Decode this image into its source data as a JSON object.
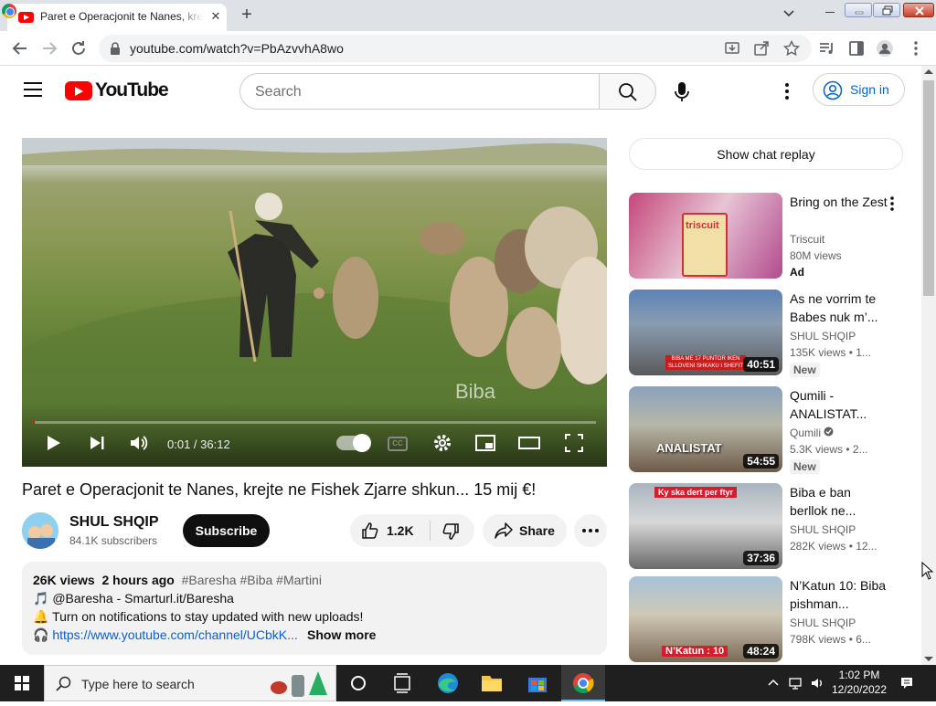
{
  "browser": {
    "tab_title": "Paret e Operacjonit te Nanes, krejte ne Fishek Zjarre shkun... 15 mij €!",
    "url": "youtube.com/watch?v=PbAzvvhA8wo"
  },
  "masthead": {
    "logo_text": "YouTube",
    "search_placeholder": "Search",
    "signin_label": "Sign in"
  },
  "player": {
    "watermark": "Biba",
    "time": "0:01 / 36:12",
    "progress_fraction": 0.0005,
    "cc_label": "CC"
  },
  "video": {
    "title": "Paret e Operacjonit te Nanes, krejte ne Fishek Zjarre shkun... 15 mij €!",
    "channel": "SHUL SHQIP",
    "subscribers": "84.1K subscribers",
    "subscribe_label": "Subscribe",
    "likes": "1.2K",
    "share_label": "Share"
  },
  "description": {
    "views": "26K views",
    "age": "2 hours ago",
    "tags": "#Baresha #Biba #Martini",
    "line1": "@Baresha - Smarturl.it/Baresha",
    "line2": "Turn on notifications to stay updated with new uploads!",
    "link": "https://www.youtube.com/channel/UCbkK...",
    "show_more": "Show more"
  },
  "sidebar": {
    "chat_replay": "Show chat replay",
    "recommendations": [
      {
        "title": "Bring on the Zest",
        "channel": "Triscuit",
        "views": "80M views",
        "badge": "Ad",
        "duration": "",
        "thumb_text": "triscuit"
      },
      {
        "title": "As ne vorrim te Babes nuk m’...",
        "channel": "SHUL SHQIP",
        "views": "135K views • 1...",
        "badge": "New",
        "duration": "40:51",
        "thumb_text": "BIBA ME 17 PUNTOR IKEN SLLOVENI SHKAKU I SHEFIT"
      },
      {
        "title": "Qumili - ANALISTAT...",
        "channel": "Qumili",
        "views": "5.3K views • 2...",
        "badge": "New",
        "duration": "54:55",
        "thumb_text": "ANALISTAT"
      },
      {
        "title": "Biba e ban berllok ne...",
        "channel": "SHUL SHQIP",
        "views": "282K views • 12...",
        "badge": "",
        "duration": "37:36",
        "thumb_text": "Ky ska dert per ftyr"
      },
      {
        "title": "N’Katun 10: Biba pishman...",
        "channel": "SHUL SHQIP",
        "views": "798K views • 6...",
        "badge": "",
        "duration": "48:24",
        "thumb_text": "N’Katun : 10"
      }
    ]
  },
  "taskbar": {
    "search_text": "Type here to search",
    "time": "1:02 PM",
    "date": "12/20/2022"
  },
  "colors": {
    "youtube_red": "#ff0000",
    "link_blue": "#065fd4",
    "taskbar": "#1f1f1f"
  }
}
